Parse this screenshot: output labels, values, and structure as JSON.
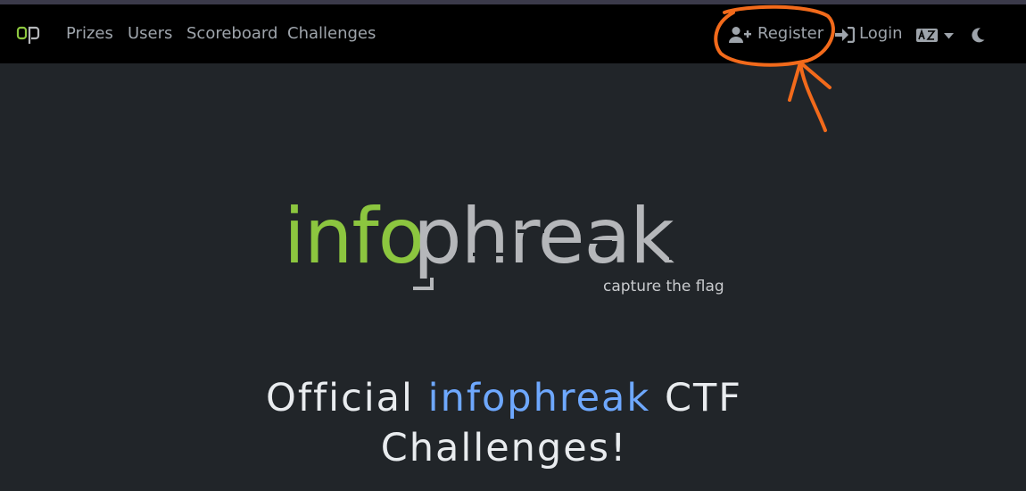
{
  "navbar": {
    "brand_text": "op",
    "links": [
      "Prizes",
      "Users",
      "Scoreboard",
      "Challenges"
    ],
    "register_label": "Register",
    "login_label": "Login"
  },
  "hero": {
    "logo_part1": "info",
    "logo_part2": "phreak",
    "logo_tagline": "capture the flag",
    "title_prefix": "Official",
    "title_accent": "infophreak",
    "title_suffix": "CTF",
    "title_line2": "Challenges!"
  },
  "colors": {
    "navbar_bg": "#000000",
    "page_bg": "#212529",
    "accent_blue": "#6ea8fe",
    "logo_green": "#8cc63f",
    "annotation_orange": "#f26a1b"
  },
  "icons": [
    "user-plus-icon",
    "sign-in-icon",
    "language-icon",
    "caret-down-icon",
    "moon-icon"
  ]
}
